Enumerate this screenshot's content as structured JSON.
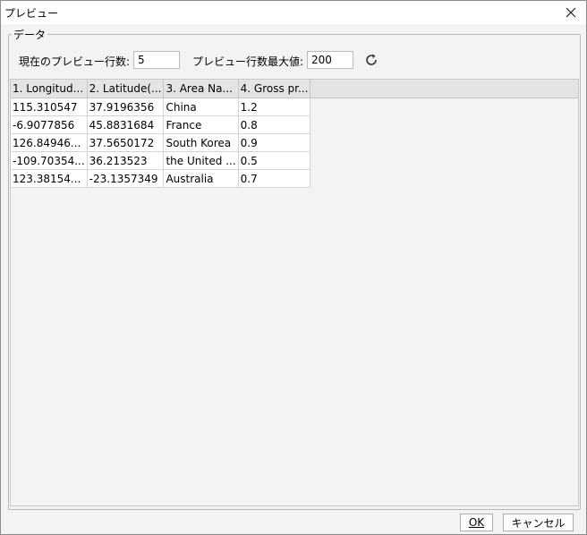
{
  "window": {
    "title": "プレビュー"
  },
  "group": {
    "legend": "データ"
  },
  "controls": {
    "current_rows_label": "現在のプレビュー行数:",
    "current_rows_value": "5",
    "max_rows_label": "プレビュー行数最大値:",
    "max_rows_value": "200"
  },
  "table": {
    "columns": [
      "1. Longitud...",
      "2. Latitude(...",
      "3. Area Na...",
      "4. Gross pr..."
    ],
    "rows": [
      [
        "115.310547",
        "37.9196356",
        "China",
        "1.2"
      ],
      [
        "-6.9077856",
        "45.8831684",
        "France",
        "0.8"
      ],
      [
        "126.84946...",
        "37.5650172",
        "South Korea",
        "0.9"
      ],
      [
        "-109.70354...",
        "36.213523",
        "the United ...",
        "0.5"
      ],
      [
        "123.38154...",
        "-23.1357349",
        "Australia",
        "0.7"
      ]
    ]
  },
  "buttons": {
    "ok_label": "OK",
    "cancel_label": "キャンセル"
  }
}
